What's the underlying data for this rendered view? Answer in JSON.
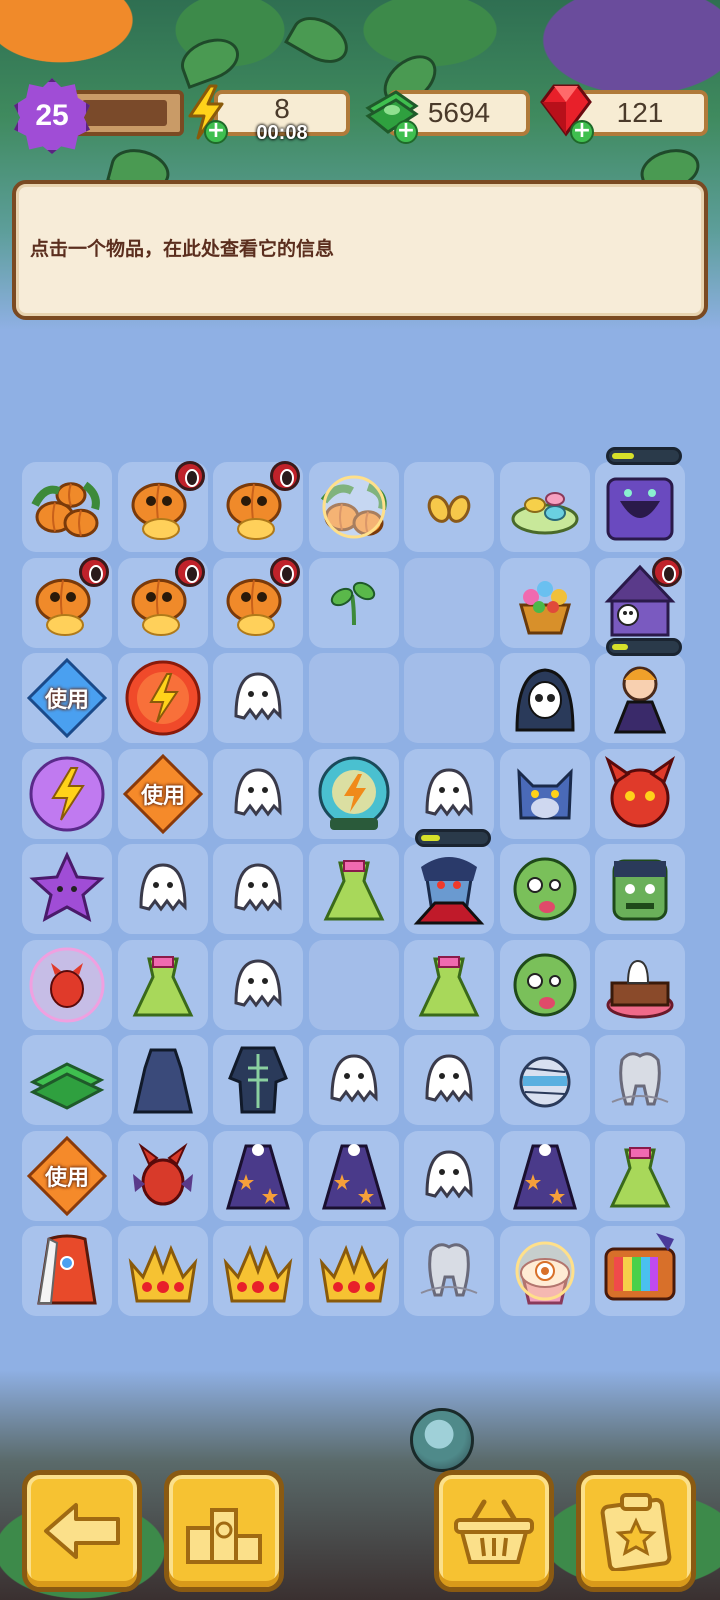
{
  "header": {
    "level": "25",
    "energy_value": "8",
    "energy_timer": "00:08",
    "cash_value": "5694",
    "gems_value": "121",
    "xp_fraction": 0.9
  },
  "info_panel": {
    "text": "点击一个物品，在此处查看它的信息"
  },
  "use_label": "使用",
  "icons": {
    "level": "star-badge-icon",
    "energy": "lightning-icon",
    "cash": "cash-stack-icon",
    "gems": "ruby-gem-icon",
    "add": "plus-icon"
  },
  "colors": {
    "background": "#8fb0e4",
    "panel": "#f7ecd8",
    "accent": "#f6c232",
    "level": "#a04dd6",
    "add": "#3fbf4f"
  },
  "board": {
    "rows": [
      [
        "pumpkin-patch",
        "pumpkin-cannon",
        "pumpkin-cannon",
        "pumpkin-patch-bubble",
        "seeds",
        "candy-plate",
        "purple-monster-box"
      ],
      [
        "pumpkin-cannon",
        "pumpkin-cannon",
        "pumpkin-cannon",
        "sprout",
        "",
        "flower-basket",
        "skull-tent"
      ],
      [
        "use-blue-diamond",
        "energy-orb-red",
        "ghost",
        "",
        "",
        "grim-reaper",
        "vampire-girl"
      ],
      [
        "energy-orb-purple",
        "use-orange-diamond",
        "ghost",
        "energy-ghost-ball",
        "ghost",
        "werewolf",
        "red-devil"
      ],
      [
        "purple-star",
        "ghost",
        "ghost",
        "green-dress",
        "dracula",
        "zombie-head",
        "frankenstein"
      ],
      [
        "devil-bubble",
        "green-dress",
        "ghost",
        "",
        "green-dress",
        "zombie-head",
        "ghost-cake"
      ],
      [
        "cash-stack",
        "dark-cloak",
        "skeleton-costume",
        "ghost",
        "ghost",
        "mummy-head",
        "tooth-web"
      ],
      [
        "use-orange-diamond",
        "red-devil-imp",
        "star-cape",
        "star-cape",
        "ghost",
        "star-cape",
        "green-dress"
      ],
      [
        "royal-robe",
        "gold-crown",
        "gold-crown",
        "gold-crown",
        "tooth-web",
        "cupcake-bubble",
        "retro-tv"
      ]
    ],
    "timer_badges": [
      [
        0,
        1
      ],
      [
        0,
        2
      ],
      [
        1,
        0
      ],
      [
        1,
        1
      ],
      [
        1,
        2
      ],
      [
        1,
        6
      ]
    ],
    "progress": [
      {
        "cell": [
          0,
          6
        ],
        "fill": 0.35
      },
      {
        "cell": [
          2,
          6
        ],
        "fill": 0.25
      },
      {
        "cell": [
          4,
          4
        ],
        "fill": 0.3
      }
    ]
  },
  "bottom_bar": {
    "buttons": [
      "back-arrow-icon",
      "leaderboard-icon",
      "basket-icon",
      "task-clipboard-icon"
    ]
  }
}
